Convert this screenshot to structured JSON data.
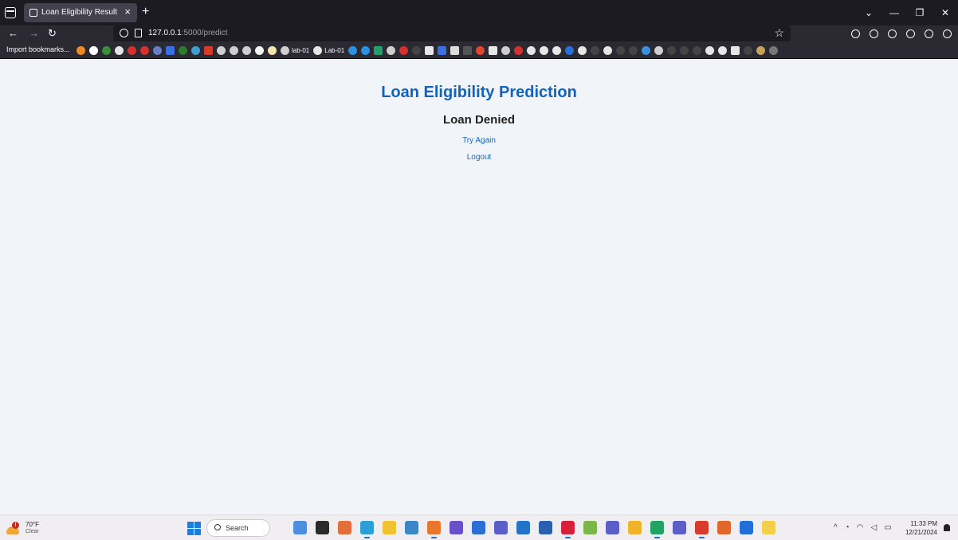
{
  "browser": {
    "tab_title": "Loan Eligibility Result",
    "tab_close": "×",
    "new_tab": "+",
    "url_host": "127.0.0.1",
    "url_path": ":5000/predict",
    "bookmarks_import": "Import bookmarks...",
    "bookmark_lab_a": "lab-01",
    "bookmark_lab_b": "Lab-01"
  },
  "page": {
    "title": "Loan Eligibility Prediction",
    "result": "Loan Denied",
    "try_again": "Try Again",
    "logout": "Logout"
  },
  "taskbar": {
    "weather_temp": "70°F",
    "weather_condition": "Clear",
    "search_label": "Search",
    "time": "11:33 PM",
    "date": "12/21/2024"
  },
  "colors": {
    "title_blue": "#1163bd",
    "link_blue": "#1367c3",
    "page_bg": "#f1f4f9",
    "chrome_dark": "#1c1b22"
  }
}
